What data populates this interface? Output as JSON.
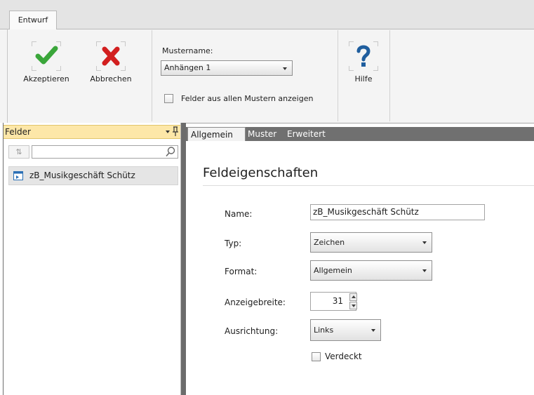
{
  "ribbon": {
    "tab_label": "Entwurf",
    "accept_label": "Akzeptieren",
    "cancel_label": "Abbrechen",
    "muster_label": "Mustername:",
    "muster_value": "Anhängen 1",
    "show_all_fields_label": "Felder aus allen Mustern anzeigen",
    "show_all_fields_checked": false,
    "help_label": "Hilfe",
    "icons": {
      "accept": "checkmark-icon",
      "cancel": "x-icon",
      "help": "question-icon"
    }
  },
  "left_pane": {
    "header": "Felder",
    "sort_icon": "sort-icon",
    "search_value": "",
    "items": [
      {
        "label": "zB_Musikgeschäft Schütz",
        "icon": "field-icon"
      }
    ]
  },
  "tabs": [
    {
      "label": "Allgemein",
      "active": true
    },
    {
      "label": "Muster",
      "active": false
    },
    {
      "label": "Erweitert",
      "active": false
    }
  ],
  "properties": {
    "title": "Feldeigenschaften",
    "name_label": "Name:",
    "name_value": "zB_Musikgeschäft Schütz",
    "type_label": "Typ:",
    "type_value": "Zeichen",
    "format_label": "Format:",
    "format_value": "Allgemein",
    "width_label": "Anzeigebreite:",
    "width_value": "31",
    "alignment_label": "Ausrichtung:",
    "alignment_value": "Links",
    "hidden_label": "Verdeckt",
    "hidden_checked": false
  },
  "colors": {
    "accept_green": "#3aa63a",
    "cancel_red": "#d21f1f",
    "help_blue": "#1f5e9e",
    "panel_header": "#fde7a8",
    "tabbar": "#707070"
  }
}
